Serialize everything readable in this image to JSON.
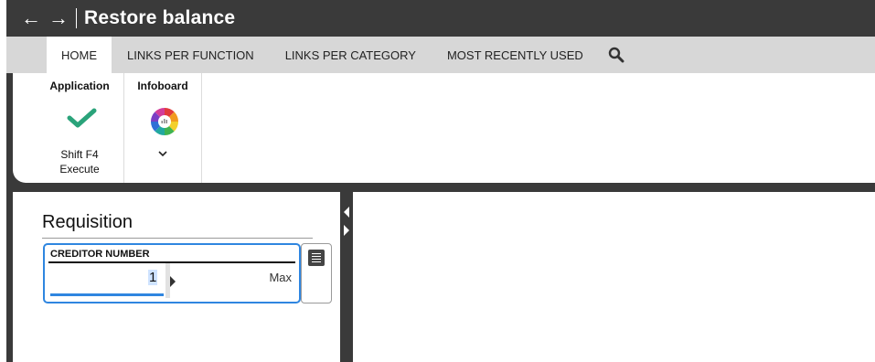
{
  "window": {
    "title": "Restore balance",
    "back_icon": "←",
    "forward_icon": "→"
  },
  "tabs": [
    {
      "label": "HOME",
      "active": true
    },
    {
      "label": "LINKS PER FUNCTION",
      "active": false
    },
    {
      "label": "LINKS PER CATEGORY",
      "active": false
    },
    {
      "label": "MOST RECENTLY USED",
      "active": false
    }
  ],
  "ribbon": {
    "application": {
      "title": "Application",
      "shortcut": "Shift F4",
      "action": "Execute",
      "icon": "check-icon"
    },
    "infoboard": {
      "title": "Infoboard",
      "icon": "infoboard-wheel-icon"
    }
  },
  "panel": {
    "title": "Requisition",
    "field": {
      "label": "CREDITOR NUMBER",
      "from_value": "1",
      "to_placeholder": "Max"
    }
  },
  "colors": {
    "dark": "#3a3a3a",
    "accent": "#2f86e0",
    "check": "#2aa37a"
  }
}
